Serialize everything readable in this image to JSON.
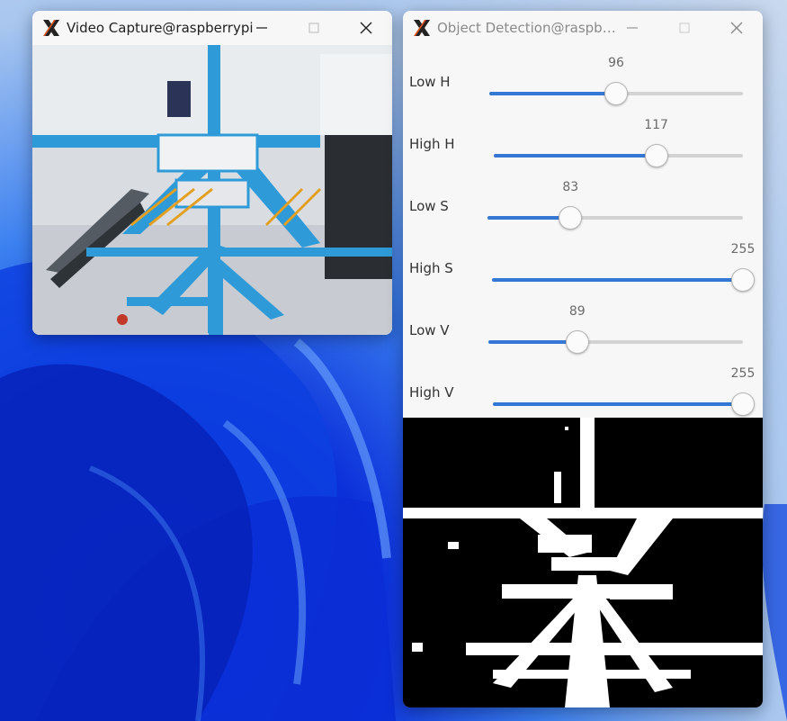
{
  "video_window": {
    "title": "Video Capture@raspberrypi",
    "controls": {
      "minimize_icon": "minimize-icon",
      "maximize_icon": "maximize-icon",
      "close_icon": "close-icon"
    }
  },
  "detection_window": {
    "title": "Object Detection@raspbe...",
    "controls": {
      "minimize_icon": "minimize-icon",
      "maximize_icon": "maximize-icon",
      "close_icon": "close-icon"
    },
    "trackbars": [
      {
        "label": "Low H",
        "value": "96",
        "fraction": 0.5
      },
      {
        "label": "High H",
        "value": "117",
        "fraction": 0.652
      },
      {
        "label": "Low S",
        "value": "83",
        "fraction": 0.325
      },
      {
        "label": "High S",
        "value": "255",
        "fraction": 1.0
      },
      {
        "label": "Low V",
        "value": "89",
        "fraction": 0.349
      },
      {
        "label": "High V",
        "value": "255",
        "fraction": 1.0
      }
    ]
  },
  "colors": {
    "accent": "#3577d4",
    "desktop_blue": "#0b2fd9",
    "steel_blue": "#2f9ad8"
  }
}
